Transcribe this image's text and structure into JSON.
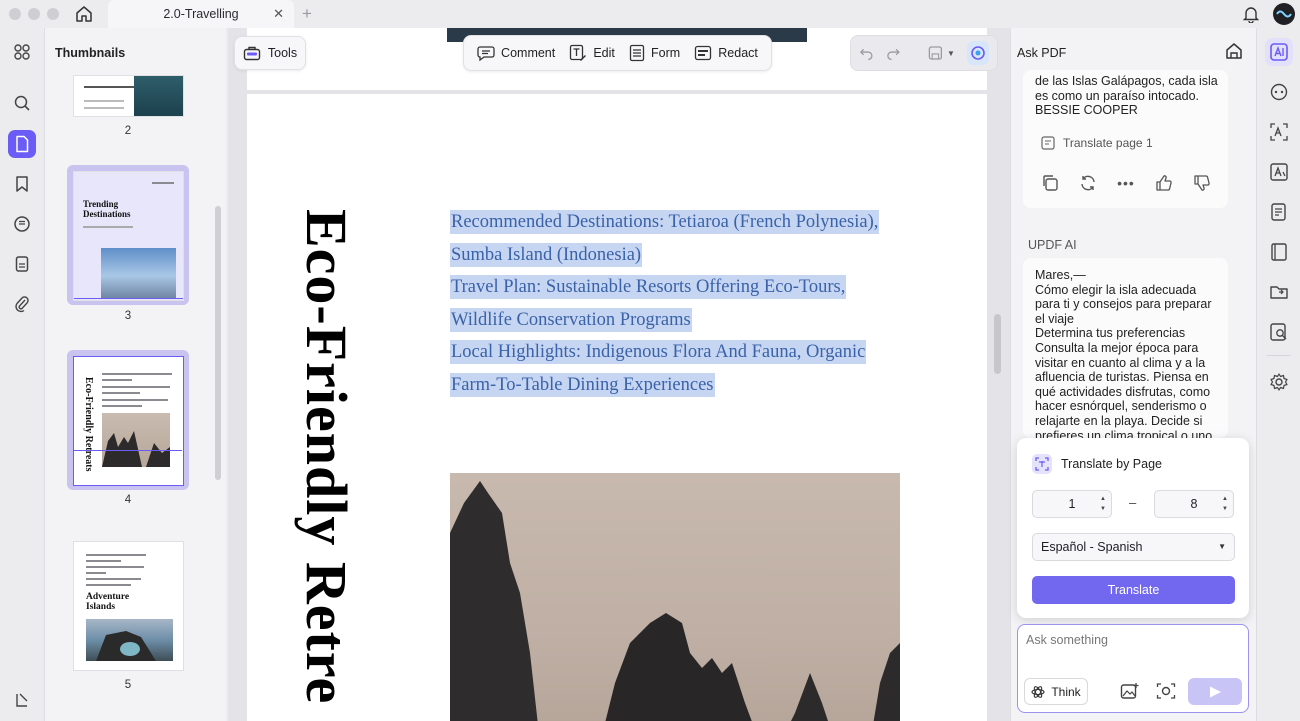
{
  "tabs": {
    "title": "2.0-Travelling"
  },
  "thumbnails": {
    "title": "Thumbnails",
    "pages": [
      {
        "num": "2",
        "heading": ""
      },
      {
        "num": "3",
        "heading": "Trending Destinations"
      },
      {
        "num": "4",
        "heading": "Eco-Friendly Retreats"
      },
      {
        "num": "5",
        "heading": "Adventure Islands"
      }
    ]
  },
  "toolbar": {
    "tools": "Tools",
    "comment": "Comment",
    "edit": "Edit",
    "form": "Form",
    "redact": "Redact"
  },
  "document": {
    "vertical_title": "Eco-Friendly Retre",
    "highlighted_lines": [
      "Recommended Destinations: Tetiaroa (French Polynesia),",
      "Sumba Island (Indonesia)",
      "Travel Plan: Sustainable Resorts Offering Eco-Tours,",
      "Wildlife Conservation Programs",
      "Local Highlights: Indigenous Flora And Fauna, Organic",
      "Farm-To-Table Dining Experiences"
    ]
  },
  "ai_panel": {
    "title": "Ask PDF",
    "prev_message": "Galápagos, cada isla\nes como un paraíso intocado.\nBESSIE COOPER",
    "prev_message_lines": [
      "de las Islas Galápagos, cada isla",
      "es como un paraíso intocado.",
      "BESSIE COOPER"
    ],
    "translate_page_link": "Translate page 1",
    "updf_label": "UPDF AI",
    "ai_message_lines": [
      "Mares,—",
      "Cómo elegir la isla adecuada",
      "para ti y consejos para preparar",
      "el viaje",
      "Determina tus preferencias",
      "Consulta la mejor época para",
      "visitar en cuanto al clima y a la",
      "afluencia de turistas. Piensa en",
      "qué actividades disfrutas, como",
      "hacer esnórquel, senderismo o",
      "relajarte en la playa. Decide si",
      "prefieres un clima tropical o uno"
    ],
    "popup": {
      "title": "Translate by Page",
      "from_page": "1",
      "to_page": "8",
      "dash": "–",
      "language": "Español - Spanish",
      "translate_button": "Translate"
    },
    "ask": {
      "placeholder": "Ask something",
      "think": "Think"
    }
  },
  "colors": {
    "accent": "#6a5cf5",
    "highlight": "#c6d6f2",
    "highlight_text": "#3a62a8",
    "translate_button": "#7268f0"
  }
}
